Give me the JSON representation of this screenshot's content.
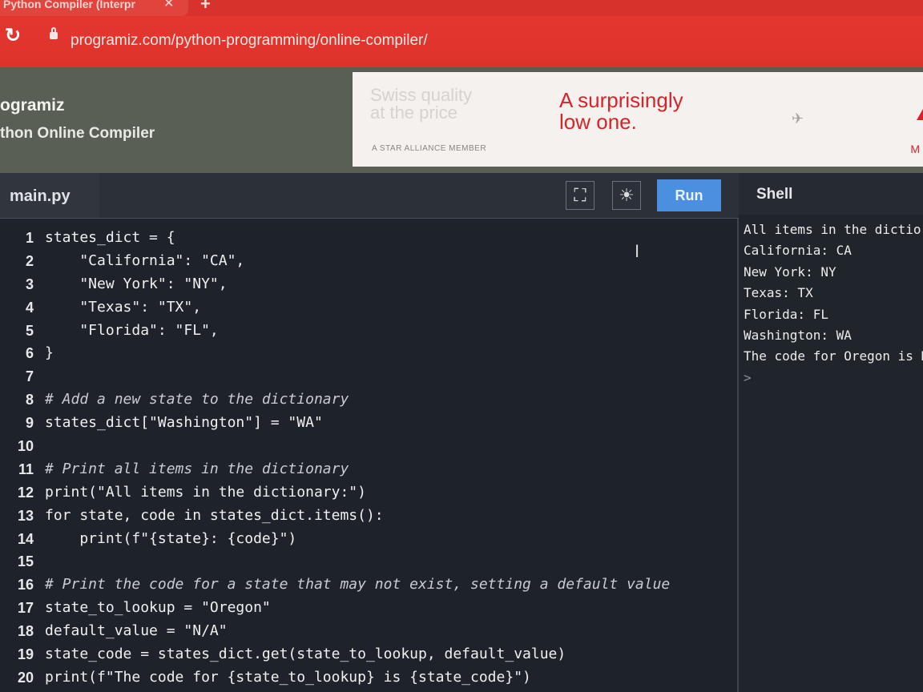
{
  "browser": {
    "tab_title": "Python Compiler (Interpr",
    "close_icon": "close-icon",
    "new_tab_icon": "plus-icon",
    "url": "programiz.com/python-programming/online-compiler/"
  },
  "site": {
    "brand": "ogramiz",
    "subtitle": "thon Online Compiler"
  },
  "ad": {
    "faded_line1": "Swiss quality",
    "faded_line2": "at the price",
    "star_alliance": "A STAR ALLIANCE MEMBER",
    "headline_line1": "A surprisingly",
    "headline_line2": "low one.",
    "more": "M"
  },
  "toolbar": {
    "filename": "main.py",
    "fullscreen_icon": "fullscreen-icon",
    "theme_icon": "sun-icon",
    "run_label": "Run",
    "shell_label": "Shell"
  },
  "editor": {
    "line_numbers": [
      "1",
      "2",
      "3",
      "4",
      "5",
      "6",
      "7",
      "8",
      "9",
      "10",
      "11",
      "12",
      "13",
      "14",
      "15",
      "16",
      "17",
      "18",
      "19",
      "20"
    ],
    "lines": [
      "states_dict = {",
      "    \"California\": \"CA\",",
      "    \"New York\": \"NY\",",
      "    \"Texas\": \"TX\",",
      "    \"Florida\": \"FL\",",
      "}",
      "",
      "# Add a new state to the dictionary",
      "states_dict[\"Washington\"] = \"WA\"",
      "",
      "# Print all items in the dictionary",
      "print(\"All items in the dictionary:\")",
      "for state, code in states_dict.items():",
      "    print(f\"{state}: {code}\")",
      "",
      "# Print the code for a state that may not exist, setting a default value",
      "state_to_lookup = \"Oregon\"",
      "default_value = \"N/A\"",
      "state_code = states_dict.get(state_to_lookup, default_value)",
      "print(f\"The code for {state_to_lookup} is {state_code}\")"
    ]
  },
  "shell": {
    "output": [
      "All items in the dictior",
      "California: CA",
      "New York: NY",
      "Texas: TX",
      "Florida: FL",
      "Washington: WA",
      "The code for Oregon is N"
    ],
    "prompt": ">"
  }
}
